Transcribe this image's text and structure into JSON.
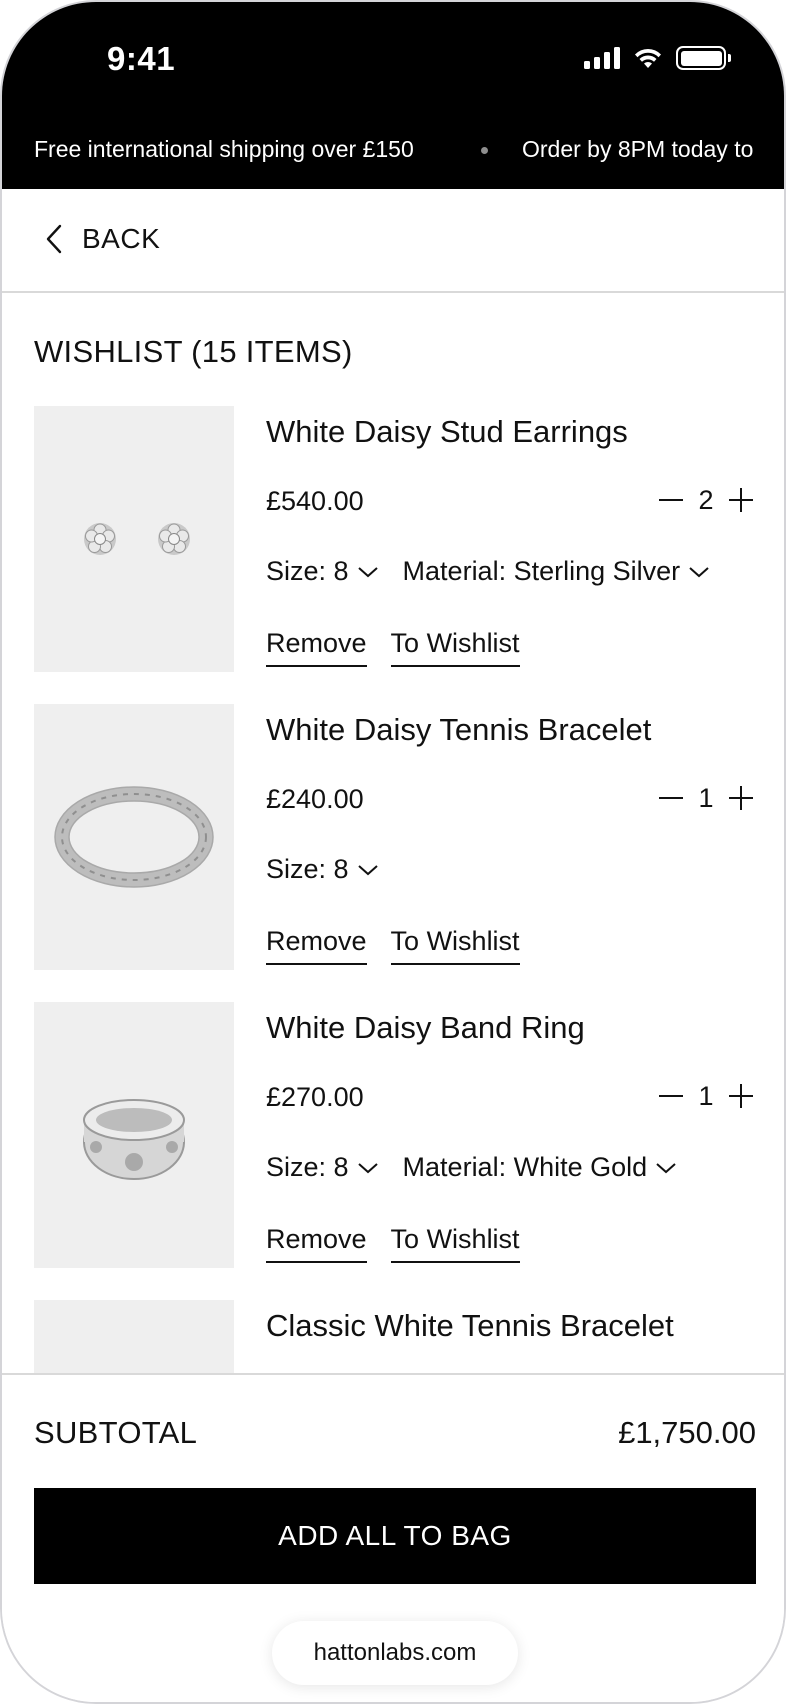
{
  "status_bar": {
    "time": "9:41"
  },
  "ticker": {
    "message_1": "Free international shipping over £150",
    "message_2": "Order by 8PM today to"
  },
  "nav": {
    "back_label": "BACK"
  },
  "wishlist": {
    "title": "WISHLIST (15 ITEMS)"
  },
  "items": [
    {
      "name": "White Daisy Stud Earrings",
      "price": "£540.00",
      "quantity": "2",
      "size": "Size: 8",
      "material": "Material: Sterling Silver",
      "remove_label": "Remove",
      "wishlist_label": "To Wishlist"
    },
    {
      "name": "White Daisy Tennis Bracelet",
      "price": "£240.00",
      "quantity": "1",
      "size": "Size: 8",
      "remove_label": "Remove",
      "wishlist_label": "To Wishlist"
    },
    {
      "name": "White Daisy Band Ring",
      "price": "£270.00",
      "quantity": "1",
      "size": "Size: 8",
      "material": "Material: White Gold",
      "remove_label": "Remove",
      "wishlist_label": "To Wishlist"
    },
    {
      "name": "Classic White Tennis Bracelet"
    }
  ],
  "summary": {
    "subtotal_label": "SUBTOTAL",
    "subtotal_value": "£1,750.00",
    "cta_label": "ADD ALL TO BAG"
  },
  "browser": {
    "url": "hattonlabs.com"
  },
  "colors": {
    "background": "#ffffff",
    "header": "#000000",
    "thumb_bg": "#efefef",
    "divider": "#d9d9d9"
  }
}
